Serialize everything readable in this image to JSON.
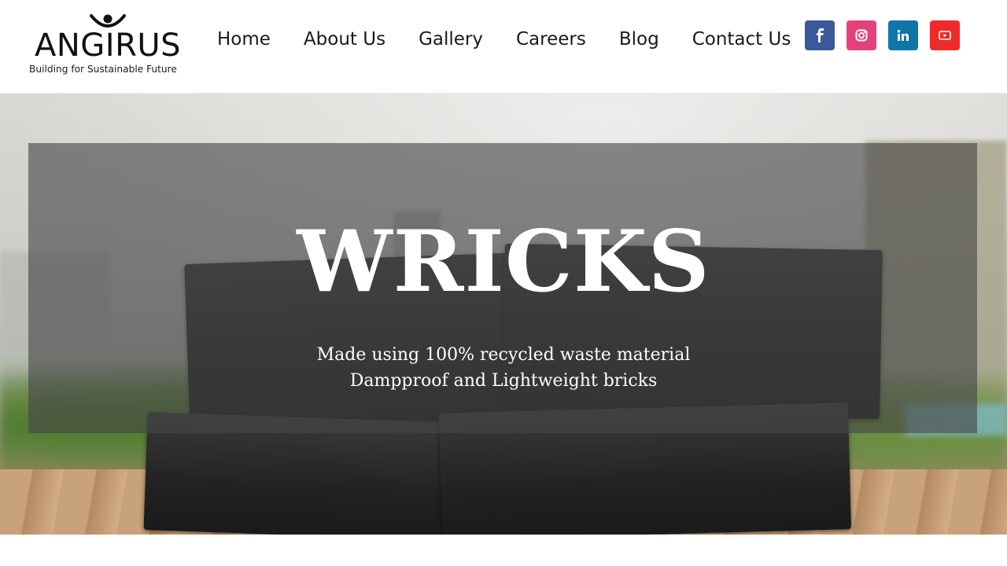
{
  "brand": {
    "name": "ANGIRUS",
    "tagline": "Building for Sustainable Future"
  },
  "nav": {
    "items": [
      {
        "label": "Home"
      },
      {
        "label": "About Us"
      },
      {
        "label": "Gallery"
      },
      {
        "label": "Careers"
      },
      {
        "label": "Blog"
      },
      {
        "label": "Contact Us"
      }
    ]
  },
  "social": [
    {
      "icon": "facebook-icon",
      "color": "#3b5998"
    },
    {
      "icon": "instagram-icon",
      "color": "#e4407a"
    },
    {
      "icon": "linkedin-icon",
      "color": "#0e76a8"
    },
    {
      "icon": "youtube-icon",
      "color": "#ee2a2a"
    }
  ],
  "hero": {
    "title": "WRICKS",
    "line1": "Made using 100% recycled waste material",
    "line2": "Dampproof and Lightweight bricks"
  }
}
